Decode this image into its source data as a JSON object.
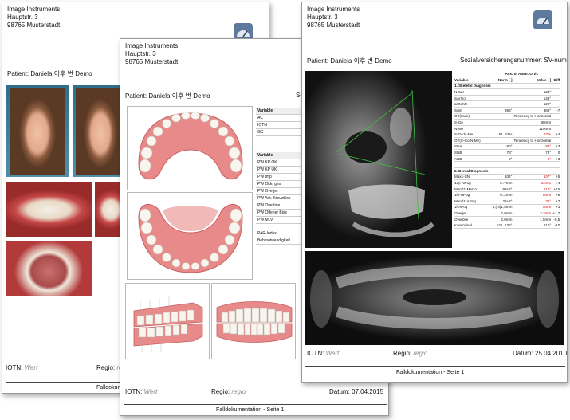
{
  "address": {
    "company": "Image Instruments",
    "street": "Hauptstr. 3",
    "city": "98765 Musterstadt"
  },
  "patient_label": "Patient: Daniela 이후 번 Demo",
  "sv_label": "Sozialversicherungsnummer: SV-nummer",
  "sv_label_short": "Sozialve",
  "footer": {
    "iotn_label": "IOTN:",
    "iotn_value": "Wert",
    "regio_label": "Regio:",
    "regio_value": "regio",
    "datum_label": "Datum:",
    "datum_p2": "07.04.2015",
    "datum_p3": "25.04.2010",
    "page_label": "Falldokumentation - Seite 1",
    "page_label_short": "Falldokumentation"
  },
  "variables_table": {
    "group1": [
      "Variable",
      "AC",
      "IOTN",
      "GC"
    ],
    "group2": [
      "Variable",
      "PW KP OK",
      "PW KP UK",
      "PW Imp",
      "PW Okk. ges.",
      "PW Overjet",
      "PW Ant. Kreuzbiss",
      "PW Overbite",
      "PW Offener Biss",
      "PW MLV",
      "",
      "PAR-Index",
      "Beh.notwendigkeit"
    ]
  },
  "analysis": {
    "header": {
      "title": "Ass. of Austr. Orth.",
      "variable": "Variable",
      "norm": "Norm [ ]",
      "value": "Value [ ]",
      "diff": "Diff"
    },
    "rows": [
      {
        "t": "sec",
        "c0": "1. Skeletal Diagnosis"
      },
      {
        "c0": "N-Sar",
        "c1": "",
        "c2": "124°",
        "c3": ""
      },
      {
        "c0": "SArGo",
        "c1": "",
        "c2": "143°",
        "c3": ""
      },
      {
        "c0": "arGoMe",
        "c1": "",
        "c2": "122°",
        "c3": ""
      },
      {
        "c0": "Sum",
        "c1": "396°",
        "c2": "389°",
        "c3": "-7"
      },
      {
        "c0": "GT(Sum)",
        "c1": "",
        "c2": "Tendency to Horizontal",
        "c3": ""
      },
      {
        "c0": "S-Go",
        "c1": "",
        "c2": "80mm",
        "c3": ""
      },
      {
        "c0": "N-Me",
        "c1": "",
        "c2": "119mm",
        "c3": ""
      },
      {
        "c0": "S-Go:N-Me",
        "c1": "61..63%",
        "c2": "67%",
        "c3": "+4",
        "red": true
      },
      {
        "c0": "GT(S-Go:N-Me)",
        "c1": "",
        "c2": "Tendency to Horizontal",
        "c3": ""
      },
      {
        "c0": "SNA",
        "c1": "80°",
        "c2": "83°",
        "c3": "+3",
        "red": true
      },
      {
        "c0": "SNB",
        "c1": "78°",
        "c2": "78°",
        "c3": "0"
      },
      {
        "c0": "ANB",
        "c1": "2°",
        "c2": "5°",
        "c3": "+3",
        "red": true
      },
      {
        "t": "gap"
      },
      {
        "t": "sec",
        "c0": "2. Dental Diagnosis"
      },
      {
        "c0": "Max1-SN",
        "c1": "102°",
        "c2": "107°",
        "c3": "+5",
        "red": true
      },
      {
        "c0": "1op-NPog",
        "c1": "2..7mm",
        "c2": "11mm",
        "c3": "+4",
        "red": true
      },
      {
        "c0": "Mand1-MeGo",
        "c1": "93±3°",
        "c2": "110°",
        "c3": "+15",
        "red": true
      },
      {
        "c0": "1lo-NPog",
        "c1": "0..2mm",
        "c2": "8mm",
        "c3": "+6",
        "red": true
      },
      {
        "c0": "Mand1-APog",
        "c1": "22±3°",
        "c2": "32°",
        "c3": "+7",
        "red": true
      },
      {
        "c0": "1l-APog",
        "c1": "1,(m)1,5mm",
        "c2": "5mm",
        "c3": "+3",
        "red": true
      },
      {
        "c0": "Overjet",
        "c1": "2,0mm",
        "c2": "3,7mm",
        "c3": "+1,7",
        "red": true
      },
      {
        "c0": "Overbite",
        "c1": "2,0mm",
        "c2": "1,5mm",
        "c3": "-0,5"
      },
      {
        "c0": "Interincisal",
        "c1": "125..135°",
        "c2": "115°",
        "c3": "-10"
      }
    ]
  }
}
